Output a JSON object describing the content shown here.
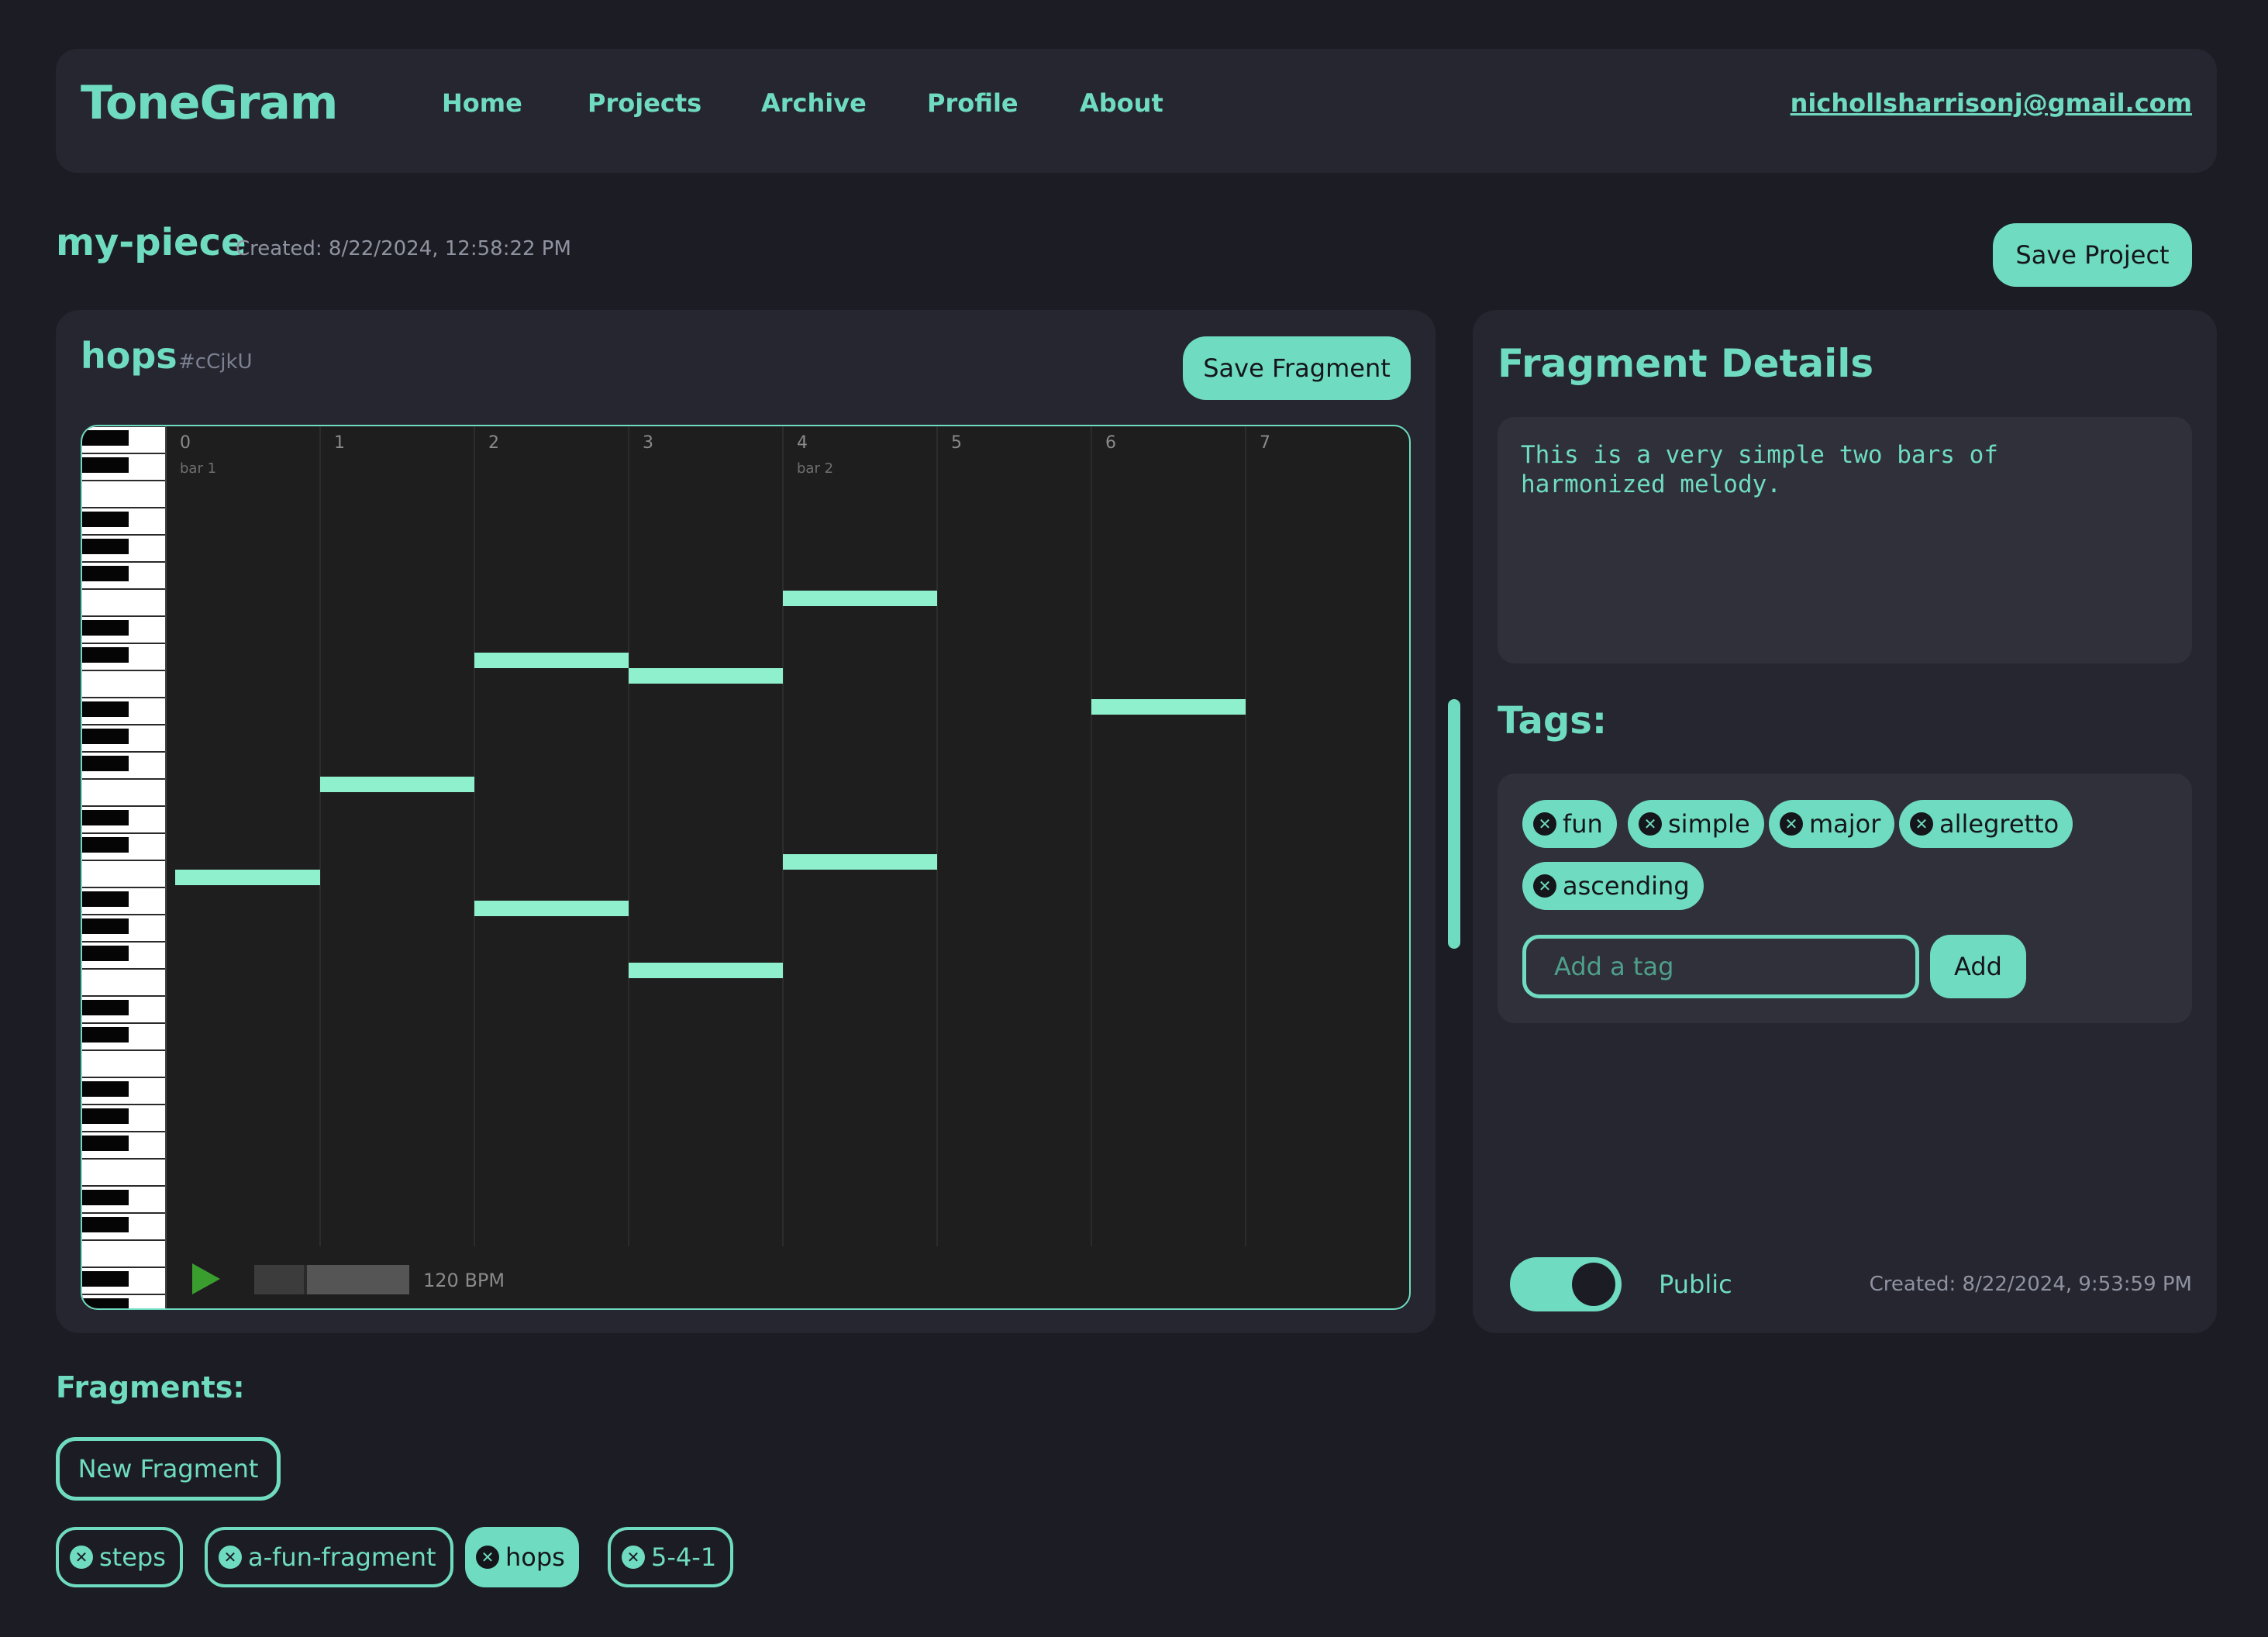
{
  "navbar": {
    "logo": "ToneGram",
    "links": [
      "Home",
      "Projects",
      "Archive",
      "Profile",
      "About"
    ],
    "user_email": "nichollsharrisonj@gmail.com"
  },
  "project": {
    "title": "my-piece",
    "created": "Created: 8/22/2024, 12:58:22 PM",
    "save_label": "Save Project"
  },
  "fragment": {
    "name": "hops",
    "id": "#cCjkU",
    "save_label": "Save Fragment",
    "beat_labels": [
      "0",
      "1",
      "2",
      "3",
      "4",
      "5",
      "6",
      "7"
    ],
    "bar_labels": [
      {
        "beat": 0,
        "label": "bar 1"
      },
      {
        "beat": 4,
        "label": "bar 2"
      }
    ],
    "notes": [
      {
        "beat": 0,
        "key": 18
      },
      {
        "beat": 1,
        "key": 21
      },
      {
        "beat": 2,
        "key": 25
      },
      {
        "beat": 2,
        "key": 17
      },
      {
        "beat": 3,
        "key": 24.5
      },
      {
        "beat": 3,
        "key": 15
      },
      {
        "beat": 4,
        "key": 27
      },
      {
        "beat": 4,
        "key": 18.5
      },
      {
        "beat": 6,
        "key": 23.5
      }
    ],
    "tempo": "120 BPM",
    "playback_progress": 0.33
  },
  "details": {
    "title": "Fragment Details",
    "description": "This is a very simple two bars of\nharmonized melody.",
    "tags_title": "Tags:",
    "tags": [
      "fun",
      "simple",
      "major",
      "allegretto",
      "ascending"
    ],
    "tag_input_placeholder": "Add a tag",
    "add_label": "Add",
    "public_label": "Public",
    "public": true,
    "created": "Created: 8/22/2024, 9:53:59 PM"
  },
  "fragments": {
    "title": "Fragments:",
    "new_label": "New Fragment",
    "items": [
      {
        "label": "steps",
        "selected": false
      },
      {
        "label": "a-fun-fragment",
        "selected": false
      },
      {
        "label": "hops",
        "selected": true
      },
      {
        "label": "5-4-1",
        "selected": false
      }
    ]
  },
  "colors": {
    "accent": "#6fdcc1",
    "note": "#8ef0cc",
    "background": "#1c1d24",
    "panel": "#25262f",
    "play": "#3a9e2f"
  }
}
